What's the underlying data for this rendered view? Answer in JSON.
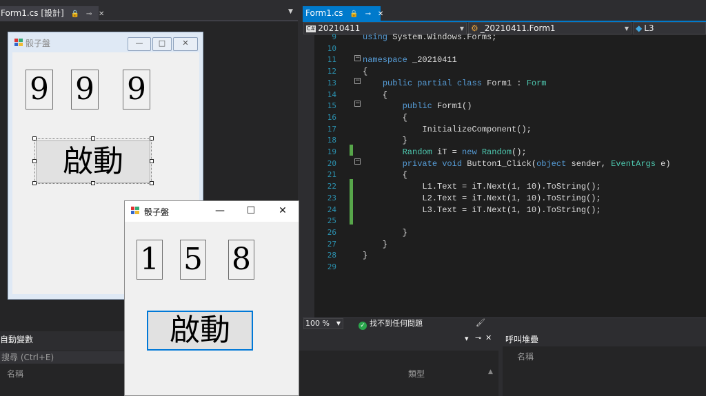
{
  "designer": {
    "tab_label": "Form1.cs [設計]",
    "form": {
      "title": "骰子盤",
      "min_glyph": "—",
      "max_glyph": "□",
      "close_glyph": "✕",
      "labels": [
        "9",
        "9",
        "9"
      ],
      "button_label": "啟動"
    }
  },
  "runtime": {
    "title": "骰子盤",
    "min_glyph": "—",
    "max_glyph": "☐",
    "close_glyph": "✕",
    "labels": [
      "1",
      "5",
      "8"
    ],
    "button_label": "啟動"
  },
  "editor": {
    "tab_label": "Form1.cs",
    "nav": {
      "project": "20210411",
      "class": "_20210411.Form1",
      "member": "L3"
    },
    "lines": [
      {
        "n": "9",
        "text": "using System.Windows.Forms;"
      },
      {
        "n": "10",
        "text": ""
      },
      {
        "n": "11",
        "text": "namespace _20210411"
      },
      {
        "n": "12",
        "text": "{"
      },
      {
        "n": "13",
        "text": "    public partial class Form1 : Form"
      },
      {
        "n": "14",
        "text": "    {"
      },
      {
        "n": "15",
        "text": "        public Form1()"
      },
      {
        "n": "16",
        "text": "        {"
      },
      {
        "n": "17",
        "text": "            InitializeComponent();"
      },
      {
        "n": "18",
        "text": "        }"
      },
      {
        "n": "19",
        "text": "        Random iT = new Random();"
      },
      {
        "n": "20",
        "text": "        private void Button1_Click(object sender, EventArgs e)"
      },
      {
        "n": "21",
        "text": "        {"
      },
      {
        "n": "22",
        "text": "            L1.Text = iT.Next(1, 10).ToString();"
      },
      {
        "n": "23",
        "text": "            L2.Text = iT.Next(1, 10).ToString();"
      },
      {
        "n": "24",
        "text": "            L3.Text = iT.Next(1, 10).ToString();"
      },
      {
        "n": "25",
        "text": ""
      },
      {
        "n": "26",
        "text": "        }"
      },
      {
        "n": "27",
        "text": "    }"
      },
      {
        "n": "28",
        "text": "}"
      },
      {
        "n": "29",
        "text": ""
      }
    ],
    "zoom": "100 %",
    "issues": "找不到任何問題"
  },
  "panels": {
    "autos": {
      "title": "自動變數",
      "search_placeholder": "搜尋 (Ctrl+E)",
      "col_name": "名稱",
      "col_type": "類型"
    },
    "callstack": {
      "title": "呼叫堆疊",
      "col_name": "名稱"
    }
  },
  "colors": {
    "accent": "#007acc",
    "keyword": "#569cd6",
    "type": "#4ec9b0",
    "line_number": "#2b91af"
  }
}
